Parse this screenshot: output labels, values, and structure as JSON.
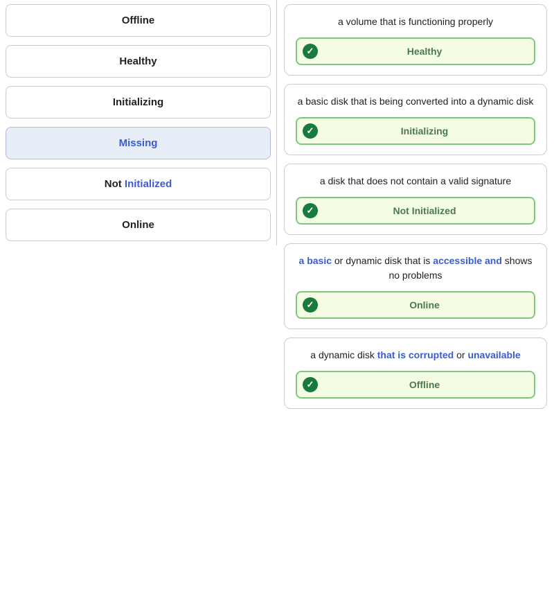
{
  "leftPanel": {
    "items": [
      {
        "id": "offline",
        "label": "Offline",
        "selected": false,
        "highlightParts": null
      },
      {
        "id": "healthy",
        "label": "Healthy",
        "selected": false,
        "highlightParts": null
      },
      {
        "id": "initializing",
        "label": "Initializing",
        "selected": false,
        "highlightParts": null
      },
      {
        "id": "missing",
        "label": "Missing",
        "selected": true,
        "highlightParts": null
      },
      {
        "id": "not-initialized",
        "label": "Not Initialized",
        "selected": false,
        "highlightParts": [
          {
            "text": "Not ",
            "blue": false
          },
          {
            "text": "Initialized",
            "blue": true
          }
        ]
      },
      {
        "id": "online",
        "label": "Online",
        "selected": false,
        "highlightParts": null
      }
    ]
  },
  "rightPanel": {
    "cards": [
      {
        "id": "card-healthy",
        "description": "a volume that is functioning properly",
        "descriptionParts": [
          {
            "text": "a volume that is functioning properly",
            "blue": false
          }
        ],
        "answerLabel": "Healthy",
        "answerHighlight": false
      },
      {
        "id": "card-initializing",
        "description": "a basic disk that is being converted into a dynamic disk",
        "descriptionParts": [
          {
            "text": "a basic disk that is being converted into a dynamic disk",
            "blue": false
          }
        ],
        "answerLabel": "Initializing",
        "answerHighlight": false
      },
      {
        "id": "card-not-initialized",
        "description": "a disk that does not contain a valid signature",
        "descriptionParts": [
          {
            "text": "a disk that does not contain a valid signature",
            "blue": false
          }
        ],
        "answerLabel": "Not Initialized",
        "answerHighlight": false
      },
      {
        "id": "card-online",
        "descriptionParts": [
          {
            "text": "a basic or",
            "blue": false
          },
          {
            "text": " ",
            "blue": false
          },
          {
            "text": "a basic",
            "blue": true,
            "override": true
          },
          {
            "text": " or ",
            "blue": false
          },
          {
            "text": "dynamic disk that is accessible and shows no problems",
            "blue": false
          },
          {
            "text": "accessible and",
            "blue": true,
            "override": true
          }
        ],
        "answerLabel": "Online",
        "answerHighlight": false
      },
      {
        "id": "card-offline",
        "descriptionParts": [
          {
            "text": "a dynamic disk ",
            "blue": false
          },
          {
            "text": "that is corrupted",
            "blue": false
          },
          {
            "text": " or unavailable",
            "blue": false
          }
        ],
        "answerLabel": "Offline",
        "answerHighlight": false
      }
    ]
  },
  "colors": {
    "blue": "#3a5bd4",
    "green_border": "#7ec87e",
    "green_bg": "#f4fce4",
    "check_bg": "#1a7a3c",
    "selected_bg": "#e8eef8"
  }
}
